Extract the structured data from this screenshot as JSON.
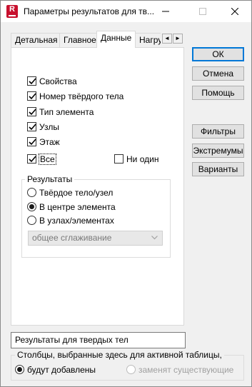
{
  "window": {
    "title": "Параметры результатов для тв...",
    "app_icon_letter": "R",
    "accent_color": "#c8102e"
  },
  "tabs": [
    {
      "label": "Детальная",
      "active": false
    },
    {
      "label": "Главное",
      "active": false
    },
    {
      "label": "Данные",
      "active": true
    },
    {
      "label": "Нагру",
      "active": false
    }
  ],
  "tab_scroll": {
    "left": "◄",
    "right": "►"
  },
  "checkboxes": [
    {
      "label": "Свойства",
      "checked": true
    },
    {
      "label": "Номер твёрдого тела",
      "checked": true
    },
    {
      "label": "Тип элемента",
      "checked": true
    },
    {
      "label": "Узлы",
      "checked": true
    },
    {
      "label": "Этаж",
      "checked": true
    },
    {
      "label": "Все",
      "checked": true
    }
  ],
  "none_checkbox": {
    "label": "Ни один",
    "checked": false
  },
  "results_group": {
    "title": "Результаты",
    "options": [
      {
        "label": "Твёрдое тело/узел",
        "selected": false
      },
      {
        "label": "В центре элемента",
        "selected": true
      },
      {
        "label": "В узлах/элементах",
        "selected": false
      }
    ],
    "smoothing": {
      "value": "общее сглаживание",
      "enabled": false
    }
  },
  "buttons": {
    "ok": "ОК",
    "cancel": "Отмена",
    "help": "Помощь",
    "filters": "Фильтры",
    "extremes": "Экстремумы",
    "variants": "Варианты"
  },
  "table_name": "Результаты для твердых тел",
  "columns_group": {
    "title": "Столбцы, выбранные здесь для активной таблицы,",
    "options": [
      {
        "label": "будут добавлены",
        "selected": true,
        "enabled": true
      },
      {
        "label": "заменят существующие",
        "selected": false,
        "enabled": false
      }
    ]
  }
}
